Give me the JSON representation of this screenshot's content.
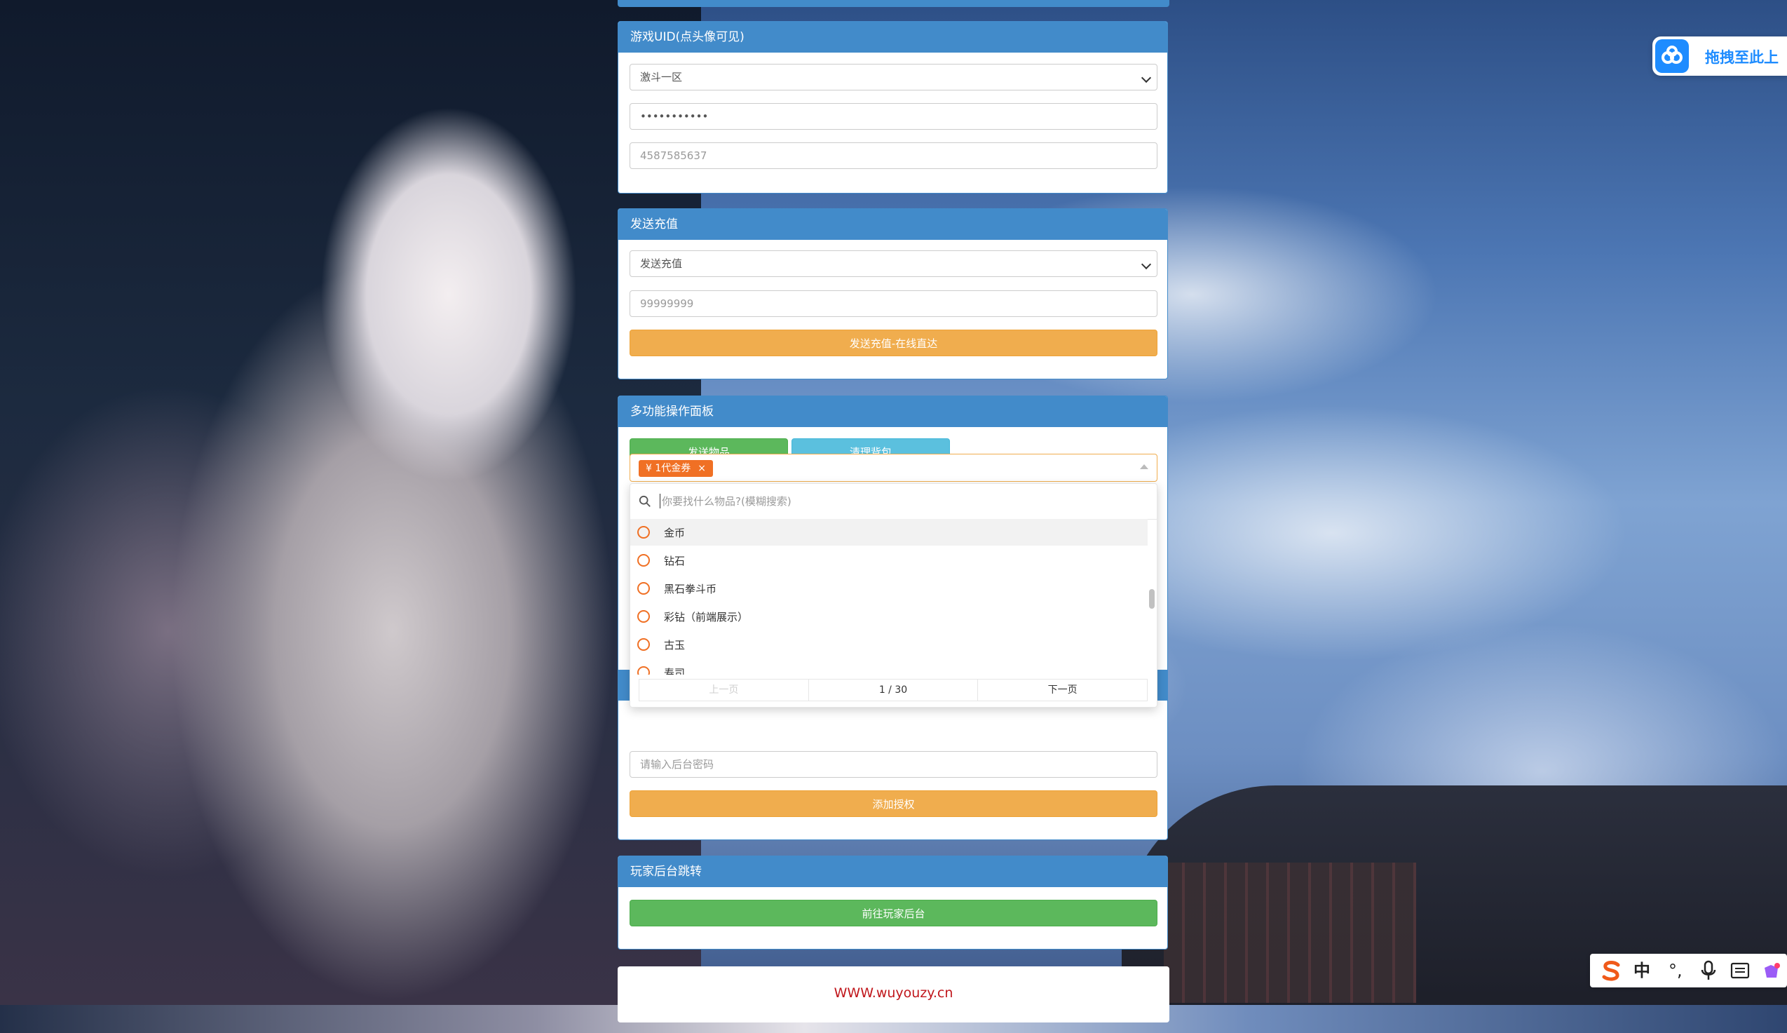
{
  "game_uid": {
    "title": "游戏UID(点头像可见)",
    "server_selected": "激斗一区",
    "password_masked": "•••••••••••",
    "uid_value": "4587585637"
  },
  "recharge": {
    "title": "发送充值",
    "type_selected": "发送充值",
    "amount_value": "99999999",
    "submit_label": "发送充值-在线直达"
  },
  "multi": {
    "title": "多功能操作面板",
    "send_items_label": "发送物品",
    "clear_bag_label": "清理背包",
    "selected_tag": "¥ 1代金券",
    "tag_close": "×",
    "search_placeholder": "你要找什么物品?(模糊搜索)",
    "items": [
      "金币",
      "钻石",
      "黑石拳斗币",
      "彩钻（前端展示）",
      "古玉",
      "寿司"
    ],
    "pager": {
      "prev": "上一页",
      "page": "1 / 30",
      "next": "下一页"
    }
  },
  "auth": {
    "password_placeholder": "请输入后台密码",
    "add_label": "添加授权"
  },
  "player_backend": {
    "title": "玩家后台跳转",
    "go_label": "前往玩家后台"
  },
  "footer": {
    "link": "WWW.wuyouzy.cn"
  },
  "cloud_widget": {
    "label": "拖拽至此上",
    "icon": "baidu-netdisk-icon"
  },
  "ime": {
    "mode": "中",
    "punct": "°,"
  },
  "colors": {
    "primary": "#428bca",
    "warning": "#f0ad4e",
    "success": "#5cb85c",
    "info": "#5bc0de",
    "tag": "#f07024",
    "footer_link": "#c0161b"
  }
}
